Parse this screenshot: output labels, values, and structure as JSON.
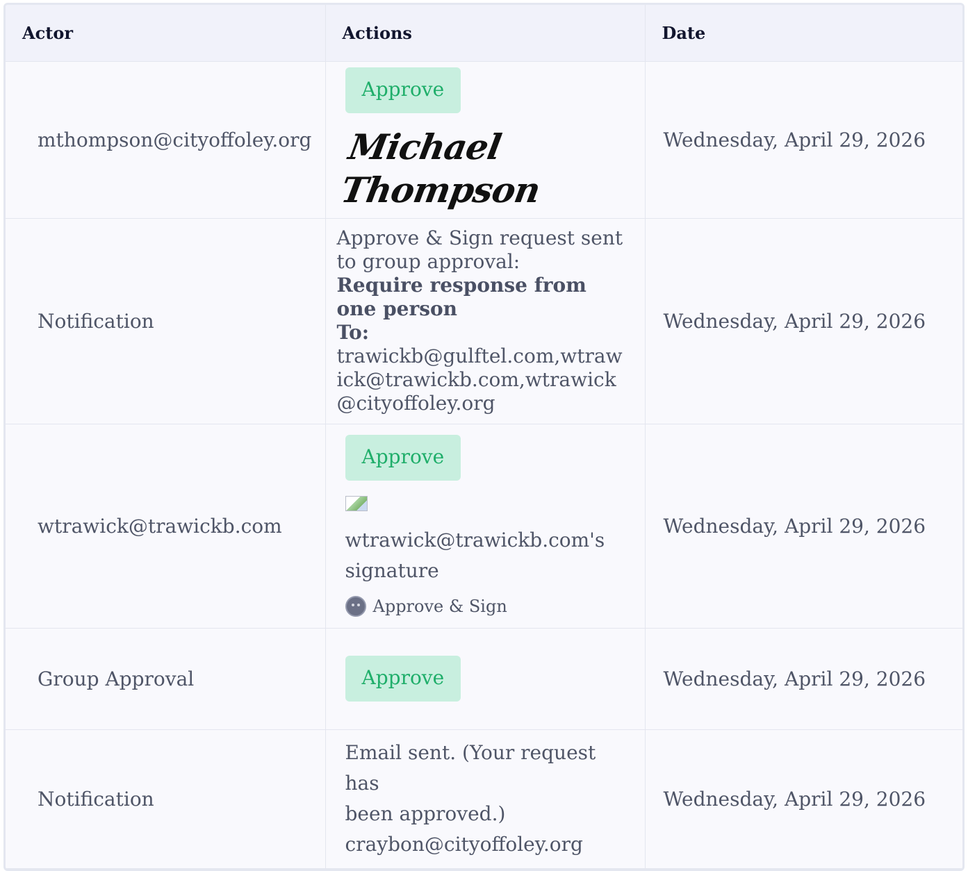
{
  "table": {
    "headers": [
      "Actor",
      "Actions",
      "Date"
    ],
    "rows": [
      {
        "actor": "mthompson@cityoffoley.org",
        "action_button": "Approve",
        "signature_text": "Michael Thompson",
        "date": "Wednesday, April 29, 2026"
      },
      {
        "actor": "Notification",
        "message_line": "Approve & Sign request sent to group approval:",
        "bold_line": "Require response from one person",
        "to_label": "To:",
        "recipients": "trawickb@gulftel.com,wtrawick@trawickb.com,wtrawick@cityoffoley.org",
        "date": "Wednesday, April 29, 2026"
      },
      {
        "actor": "wtrawick@trawickb.com",
        "action_button": "Approve",
        "signature_alt": "wtrawick@trawickb.com's signature",
        "method": "Approve & Sign",
        "date": "Wednesday, April 29, 2026"
      },
      {
        "actor": "Group Approval",
        "action_button": "Approve",
        "date": "Wednesday, April 29, 2026"
      },
      {
        "actor": "Notification",
        "email_line1": "Email sent. (Your request has",
        "email_line2": "been approved.)",
        "email_line3": "craybon@cityoffoley.org",
        "date": "Wednesday, April 29, 2026"
      }
    ]
  }
}
